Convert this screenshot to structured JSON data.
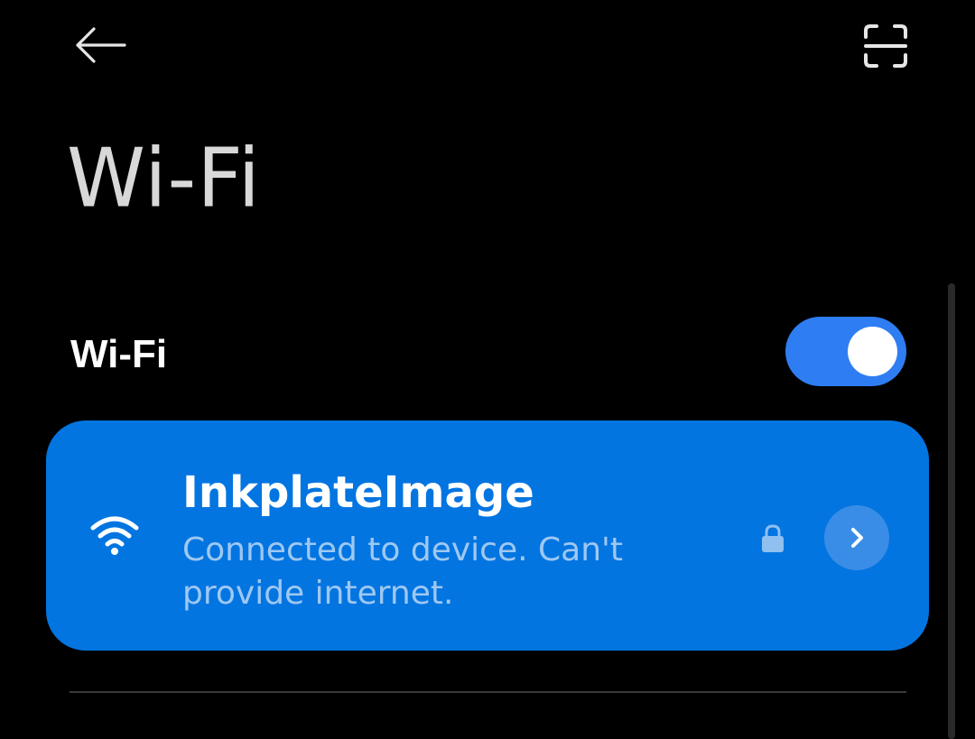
{
  "header": {
    "back_icon": "arrow-left-icon",
    "scan_icon": "scan-qr-icon",
    "title": "Wi-Fi"
  },
  "wifi_toggle": {
    "label": "Wi-Fi",
    "state": "on",
    "accent_color": "#2f7df3"
  },
  "connected_network": {
    "name": "InkplateImage",
    "status": "Connected to device. Can't provide internet.",
    "signal_icon": "wifi-signal-icon",
    "secured_icon": "lock-icon",
    "details_icon": "chevron-right-icon",
    "card_color": "#0375e1"
  }
}
